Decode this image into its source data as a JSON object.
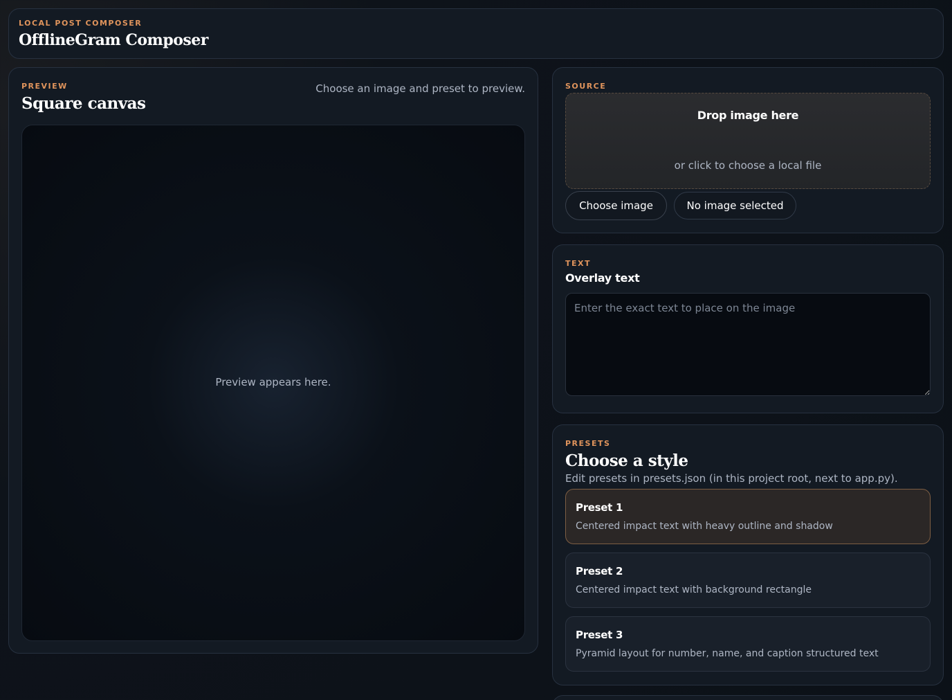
{
  "header": {
    "eyebrow": "LOCAL POST COMPOSER",
    "title": "OfflineGram Composer"
  },
  "preview": {
    "eyebrow": "PREVIEW",
    "title": "Square canvas",
    "hint": "Choose an image and preset to preview.",
    "placeholder": "Preview appears here."
  },
  "source": {
    "eyebrow": "SOURCE",
    "drop_title": "Drop image here",
    "drop_subtitle": "or click to choose a local file",
    "choose_button": "Choose image",
    "file_status": "No image selected"
  },
  "text": {
    "eyebrow": "TEXT",
    "title": "Overlay text",
    "value": "",
    "placeholder": "Enter the exact text to place on the image"
  },
  "presets": {
    "eyebrow": "PRESETS",
    "title": "Choose a style",
    "note": "Edit presets in presets.json (in this project root, next to app.py).",
    "selected": "Preset 1",
    "items": [
      {
        "name": "Preset 1",
        "description": "Centered impact text with heavy outline and shadow"
      },
      {
        "name": "Preset 2",
        "description": "Centered impact text with background rectangle"
      },
      {
        "name": "Preset 3",
        "description": "Pyramid layout for number, name, and caption structured text"
      }
    ]
  },
  "colors": {
    "accent": "#e0945c",
    "background": "#0c1118",
    "panel": "#131a23",
    "selected_preset": "#2b2726",
    "selected_border": "#7e5e43"
  }
}
